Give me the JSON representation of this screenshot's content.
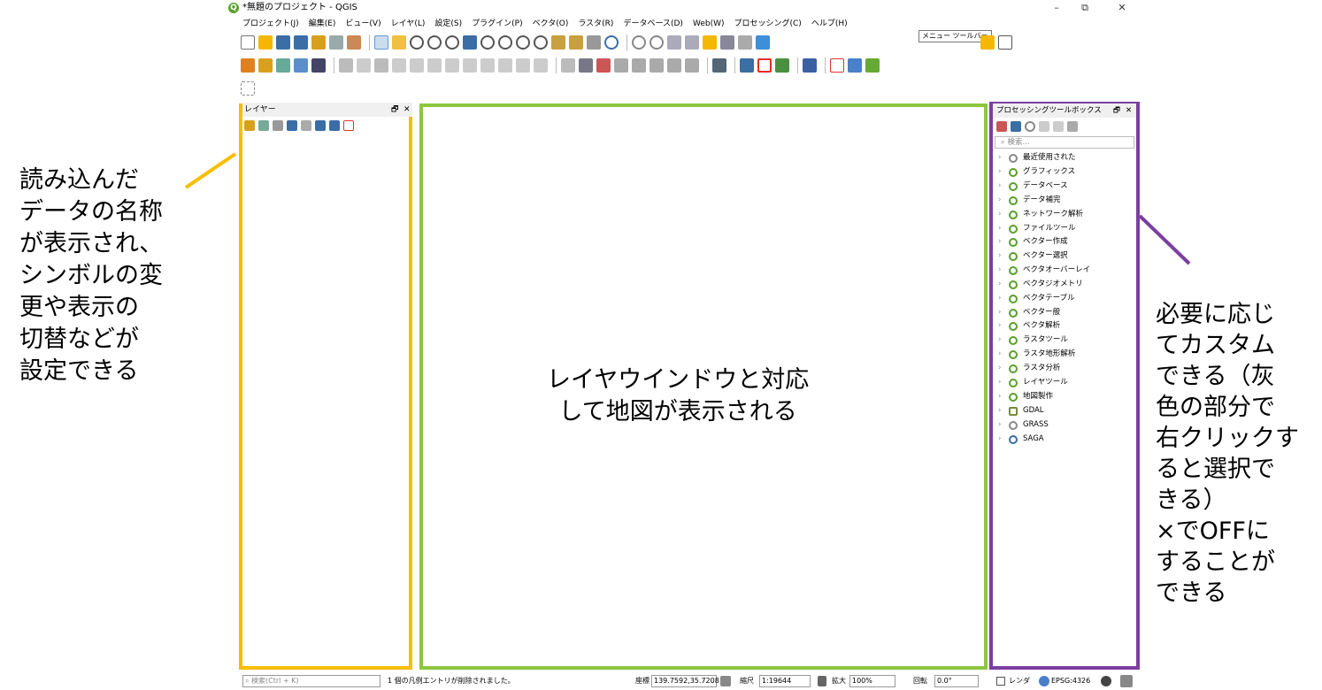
{
  "window": {
    "title": "*無題のプロジェクト - QGIS",
    "controls": {
      "minimize": "–",
      "restore": "⧉",
      "close": "✕"
    }
  },
  "menubar": [
    "プロジェクト(J)",
    "編集(E)",
    "ビュー(V)",
    "レイヤ(L)",
    "設定(S)",
    "プラグイン(P)",
    "ベクタ(O)",
    "ラスタ(R)",
    "データベース(D)",
    "Web(W)",
    "プロセッシング(C)",
    "ヘルプ(H)"
  ],
  "tooltip": "メニュー ツールバー",
  "layers_panel": {
    "title": "レイヤー",
    "float": "🗗",
    "close": "✕"
  },
  "processing_panel": {
    "title": "プロセッシングツールボックス",
    "float": "🗗",
    "close": "✕",
    "search_placeholder": "検索...",
    "items": [
      "最近使用された",
      "グラフィックス",
      "データベース",
      "データ補完",
      "ネットワーク解析",
      "ファイルツール",
      "ベクター作成",
      "ベクター選択",
      "ベクタオーバーレイ",
      "ベクタジオメトリ",
      "ベクタテーブル",
      "ベクター般",
      "ベクタ解析",
      "ラスタツール",
      "ラスタ地形解析",
      "ラスタ分析",
      "レイヤツール",
      "地図製作",
      "GDAL",
      "GRASS",
      "SAGA"
    ]
  },
  "annotations": {
    "left": [
      "読み込んだ",
      "データの名称",
      "が表示され、",
      "シンボルの変",
      "更や表示の",
      "切替などが",
      "設定できる"
    ],
    "center": [
      "レイヤウインドウと対応",
      "して地図が表示される"
    ],
    "right": [
      "必要に応じ",
      "てカスタム",
      "できる（灰",
      "色の部分で",
      "右クリックす",
      "ると選択で",
      "きる）",
      "×でOFFに",
      "することが",
      "できる"
    ]
  },
  "statusbar": {
    "search_placeholder": "検索(Ctrl + K)",
    "message": "1 個の凡例エントリが削除されました。",
    "coord_label": "座標",
    "coord_value": "139.7592,35.7208",
    "scale_label": "縮尺",
    "scale_value": "1:19644",
    "magnify_label": "拡大",
    "magnify_value": "100%",
    "rotation_label": "回転",
    "rotation_value": "0.0°",
    "render_label": "レンダ",
    "crs": "EPSG:4326"
  },
  "colors": {
    "layers_border": "#f8bd00",
    "map_border": "#8dc63f",
    "processing_border": "#7b3fa0",
    "qgis_green": "#5aa02c"
  }
}
